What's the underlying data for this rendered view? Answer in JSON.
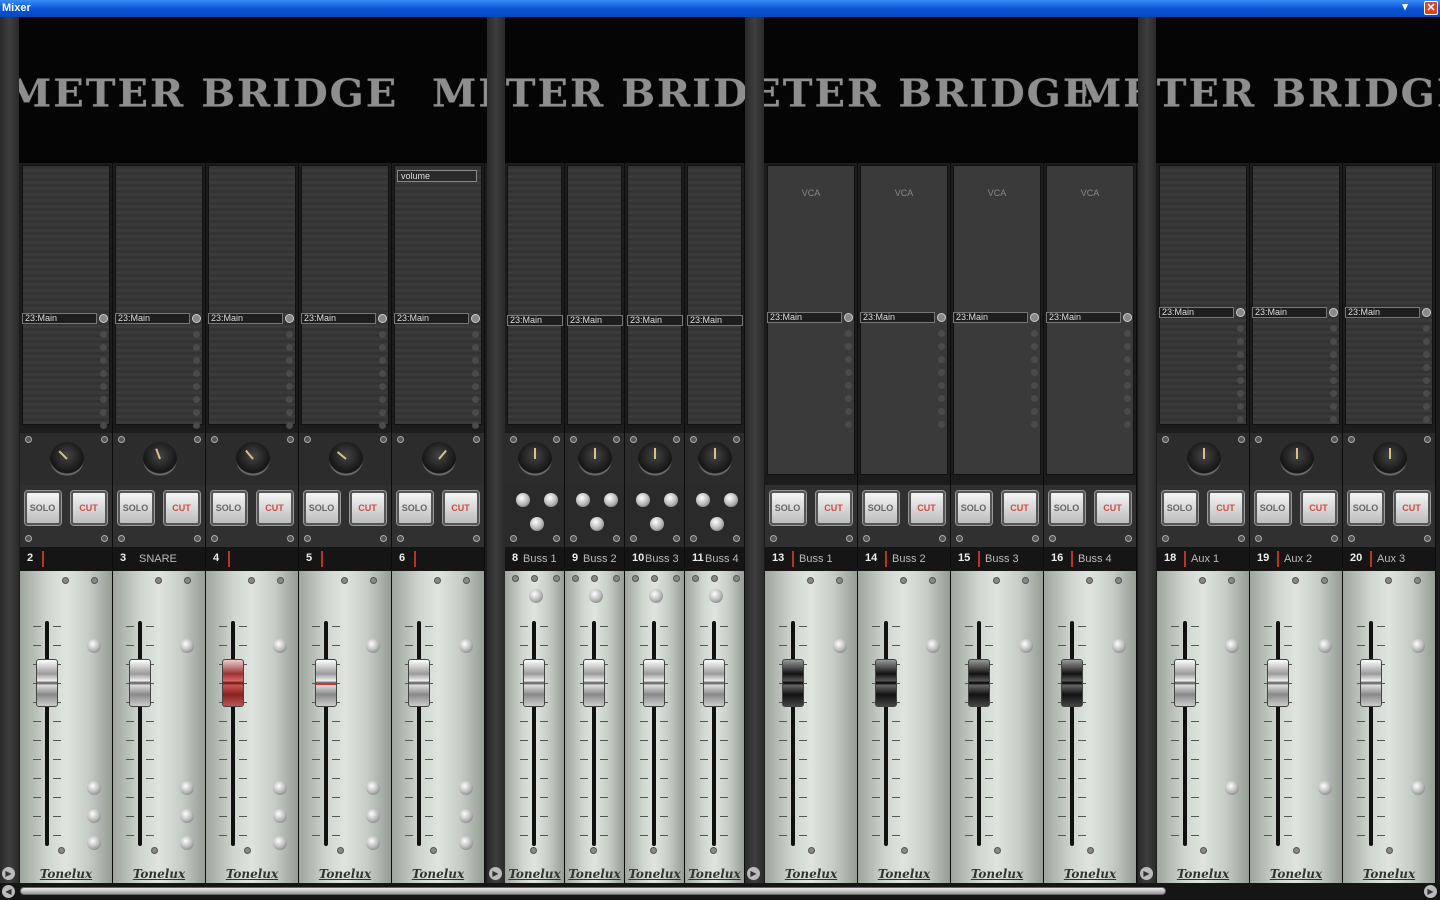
{
  "window": {
    "title": "Mixer",
    "close_label": "✕",
    "pin_label": "▾"
  },
  "meter_bridge_text": "METER BRIDGE",
  "route_default": "23:Main",
  "solo_label": "SOLO",
  "cut_label": "CUT",
  "vca_label": "VCA",
  "volume_label": "volume",
  "logo_text": "Tonelux",
  "channels": [
    {
      "num": "2",
      "name": ""
    },
    {
      "num": "3",
      "name": "SNARE"
    },
    {
      "num": "4",
      "name": ""
    },
    {
      "num": "5",
      "name": ""
    },
    {
      "num": "6",
      "name": ""
    }
  ],
  "busses_send": [
    {
      "num": "8",
      "name": "Buss 1"
    },
    {
      "num": "9",
      "name": "Buss 2"
    },
    {
      "num": "10",
      "name": "Buss 3"
    },
    {
      "num": "11",
      "name": "Buss 4"
    }
  ],
  "busses": [
    {
      "num": "13",
      "name": "Buss 1"
    },
    {
      "num": "14",
      "name": "Buss 2"
    },
    {
      "num": "15",
      "name": "Buss 3"
    },
    {
      "num": "16",
      "name": "Buss 4"
    }
  ],
  "aux": [
    {
      "num": "18",
      "name": "Aux 1"
    },
    {
      "num": "19",
      "name": "Aux 2"
    },
    {
      "num": "20",
      "name": "Aux 3"
    }
  ],
  "scroll": {
    "left": "◀",
    "right": "▶"
  }
}
